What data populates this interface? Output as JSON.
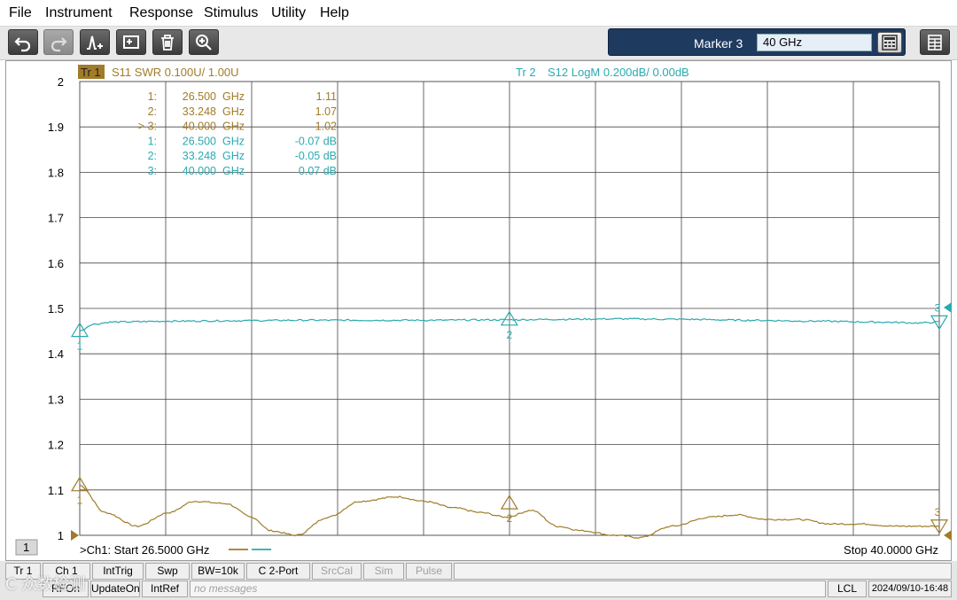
{
  "menu": [
    "File",
    "Instrument",
    "Response",
    "Stimulus",
    "Utility",
    "Help"
  ],
  "toolbar": {
    "icons": [
      "undo-icon",
      "redo-icon",
      "marker-add-icon",
      "screenshot-icon",
      "trash-icon",
      "zoom-icon"
    ],
    "marker_label": "Marker 3",
    "marker_value": "40 GHz"
  },
  "trace1": {
    "id": "Tr  1",
    "header": "S11 SWR 0.100U/  1.00U",
    "color": "#a07c28",
    "markers": [
      {
        "n": "1:",
        "freq": "26.500",
        "unit": "GHz",
        "value": "1.11"
      },
      {
        "n": "2:",
        "freq": "33.248",
        "unit": "GHz",
        "value": "1.07"
      },
      {
        "n": "> 3:",
        "freq": "40.000",
        "unit": "GHz",
        "value": "1.02"
      }
    ]
  },
  "trace2": {
    "id": "Tr  2",
    "header": "S12 LogM 0.200dB/  0.00dB",
    "color": "#2aaab0",
    "markers": [
      {
        "n": "1:",
        "freq": "26.500",
        "unit": "GHz",
        "value": "-0.07 dB"
      },
      {
        "n": "2:",
        "freq": "33.248",
        "unit": "GHz",
        "value": "-0.05 dB"
      },
      {
        "n": "3:",
        "freq": "40.000",
        "unit": "GHz",
        "value": "0.07 dB"
      }
    ]
  },
  "plot": {
    "start_text": ">Ch1:  Start  26.5000 GHz",
    "stop_text": "Stop  40.0000 GHz",
    "channel_box": "1"
  },
  "chart_data": {
    "type": "line",
    "x_range_ghz": [
      26.5,
      40.0
    ],
    "ylim": [
      1.0,
      2.0
    ],
    "yticks": [
      "2",
      "1.9",
      "1.8",
      "1.7",
      "1.6",
      "1.5",
      "1.4",
      "1.3",
      "1.2",
      "1.1",
      "1"
    ],
    "grid": true,
    "series": [
      {
        "name": "S11 SWR",
        "color": "#a07c28",
        "x": [
          26.5,
          26.9,
          27.4,
          27.9,
          28.3,
          28.8,
          29.2,
          29.5,
          29.9,
          30.4,
          30.9,
          31.5,
          31.9,
          32.4,
          32.8,
          33.2,
          33.6,
          34.0,
          34.4,
          34.9,
          35.3,
          35.8,
          36.4,
          36.8,
          37.3,
          37.8,
          38.3,
          38.8,
          39.3,
          39.7,
          40.0
        ],
        "y": [
          1.11,
          1.05,
          1.02,
          1.05,
          1.075,
          1.07,
          1.04,
          1.01,
          1.0,
          1.04,
          1.075,
          1.085,
          1.075,
          1.06,
          1.05,
          1.04,
          1.055,
          1.02,
          1.01,
          1.0,
          0.995,
          1.02,
          1.04,
          1.045,
          1.035,
          1.035,
          1.025,
          1.025,
          1.02,
          1.02,
          1.02
        ]
      },
      {
        "name": "S12 LogM",
        "color": "#2aaab0",
        "x": [
          26.5,
          26.7,
          27.0,
          28.0,
          29.0,
          30.0,
          31.0,
          32.0,
          33.248,
          34.0,
          35.0,
          36.0,
          37.0,
          38.0,
          39.0,
          39.7,
          40.0
        ],
        "y": [
          1.45,
          1.465,
          1.47,
          1.472,
          1.473,
          1.474,
          1.474,
          1.474,
          1.475,
          1.476,
          1.477,
          1.476,
          1.474,
          1.472,
          1.47,
          1.468,
          1.47
        ]
      }
    ],
    "markers": [
      {
        "label": "1",
        "x": 26.5,
        "s11": 1.11,
        "s12": 1.45
      },
      {
        "label": "2",
        "x": 33.248,
        "s11": 1.07,
        "s12": 1.475
      },
      {
        "label": "3",
        "x": 40.0,
        "s11": 1.02,
        "s12": 1.47
      }
    ]
  },
  "status": {
    "row1": [
      "Tr 1",
      "Ch 1",
      "IntTrig",
      "Swp",
      "BW=10k",
      "C  2-Port",
      "SrcCal",
      "Sim",
      "Pulse"
    ],
    "row1_dim": [
      false,
      false,
      false,
      false,
      false,
      false,
      true,
      true,
      true
    ],
    "row2": [
      "RFOn",
      "UpdateOn",
      "IntRef"
    ],
    "message": "no messages",
    "lcl": "LCL",
    "datetime": "2024/09/10-16:48"
  },
  "watermark": "C 众数检测"
}
